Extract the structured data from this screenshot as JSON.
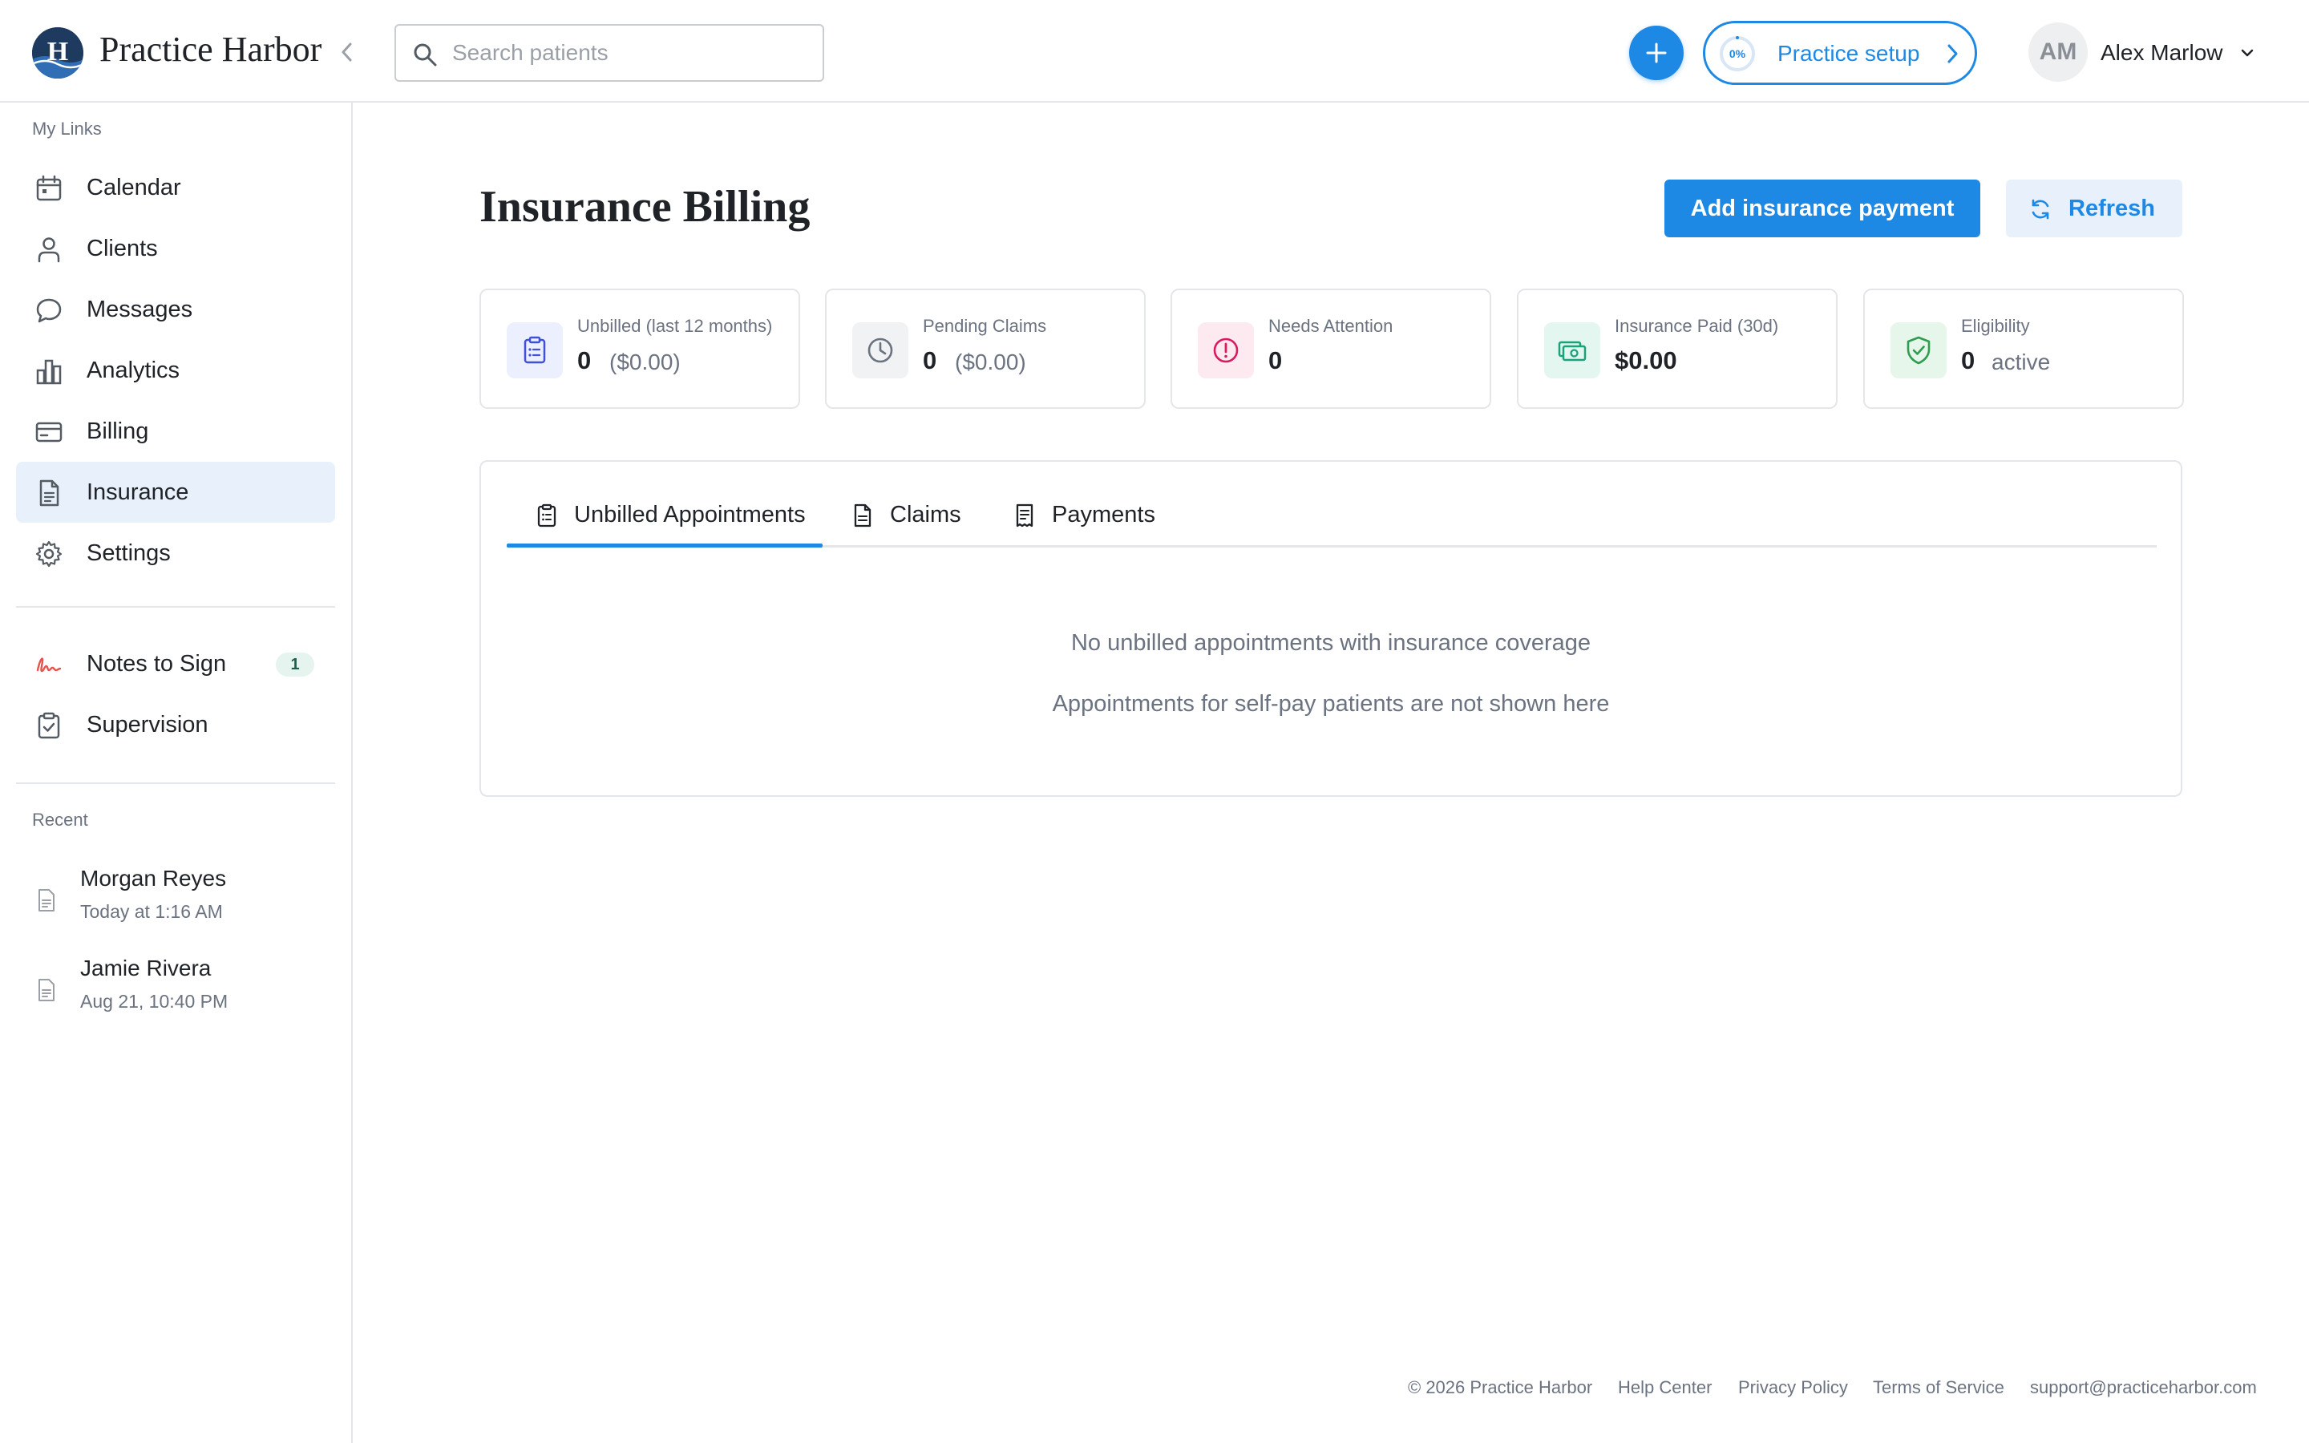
{
  "app": {
    "brand": "Practice Harbor",
    "logo_letter": "H",
    "colors": {
      "accent": "#1e88e5",
      "brand_navy": "#1e3a5f",
      "active_nav_bg": "#e8f1fb"
    }
  },
  "header": {
    "search_placeholder": "Search patients",
    "setup": {
      "percent": "0%",
      "label": "Practice setup"
    },
    "user": {
      "initials": "AM",
      "name": "Alex Marlow"
    }
  },
  "sidebar": {
    "my_links_label": "My Links",
    "items": [
      {
        "label": "Calendar",
        "icon": "calendar-icon"
      },
      {
        "label": "Clients",
        "icon": "person-icon"
      },
      {
        "label": "Messages",
        "icon": "chat-bubble-icon"
      },
      {
        "label": "Analytics",
        "icon": "bar-chart-icon"
      },
      {
        "label": "Billing",
        "icon": "credit-card-icon"
      },
      {
        "label": "Insurance",
        "icon": "document-icon",
        "active": true
      },
      {
        "label": "Settings",
        "icon": "gear-icon"
      }
    ],
    "secondary_items": [
      {
        "label": "Notes to Sign",
        "icon": "signature-icon",
        "badge": "1"
      },
      {
        "label": "Supervision",
        "icon": "clipboard-check-icon"
      }
    ],
    "recent_label": "Recent",
    "recent": [
      {
        "name": "Morgan Reyes",
        "time": "Today at 1:16 AM"
      },
      {
        "name": "Jamie Rivera",
        "time": "Aug 21, 10:40 PM"
      }
    ]
  },
  "main": {
    "title": "Insurance Billing",
    "add_payment_label": "Add insurance payment",
    "refresh_label": "Refresh",
    "stats": [
      {
        "label": "Unbilled (last 12 months)",
        "value": "0",
        "sub": "($0.00)",
        "icon": "clipboard-list-icon",
        "color": "#3f51d6"
      },
      {
        "label": "Pending Claims",
        "value": "0",
        "sub": "($0.00)",
        "icon": "clock-icon",
        "color": "#6b7280"
      },
      {
        "label": "Needs Attention",
        "value": "0",
        "sub": "",
        "icon": "alert-circle-icon",
        "color": "#d81b60"
      },
      {
        "label": "Insurance Paid (30d)",
        "value": "$0.00",
        "sub": "",
        "icon": "cash-icon",
        "color": "#1aa37a"
      },
      {
        "label": "Eligibility",
        "value": "0",
        "sub": "active",
        "icon": "shield-check-icon",
        "color": "#2e9d4f"
      }
    ],
    "tabs": [
      {
        "label": "Unbilled Appointments",
        "icon": "clipboard-list-icon",
        "active": true
      },
      {
        "label": "Claims",
        "icon": "document-icon"
      },
      {
        "label": "Payments",
        "icon": "receipt-icon"
      }
    ],
    "empty_title": "No unbilled appointments with insurance coverage",
    "empty_subtitle": "Appointments for self-pay patients are not shown here"
  },
  "footer": {
    "copyright": "© 2026 Practice Harbor",
    "links": [
      "Help Center",
      "Privacy Policy",
      "Terms of Service",
      "support@practiceharbor.com"
    ]
  }
}
